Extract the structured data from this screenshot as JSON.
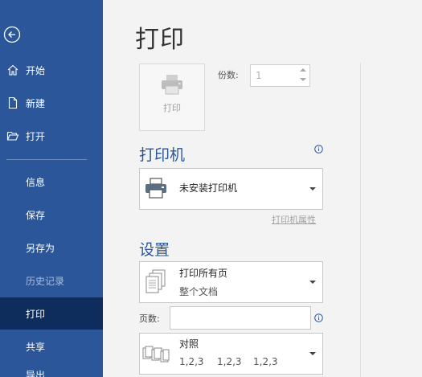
{
  "sidebar": {
    "top_items": [
      {
        "label": "开始",
        "icon": "home-icon"
      },
      {
        "label": "新建",
        "icon": "new-document-icon"
      },
      {
        "label": "打开",
        "icon": "open-folder-icon"
      }
    ],
    "items": [
      {
        "label": "信息",
        "state": "normal"
      },
      {
        "label": "保存",
        "state": "normal"
      },
      {
        "label": "另存为",
        "state": "normal"
      },
      {
        "label": "历史记录",
        "state": "disabled"
      },
      {
        "label": "打印",
        "state": "active"
      },
      {
        "label": "共享",
        "state": "normal"
      },
      {
        "label": "导出",
        "state": "normal"
      }
    ]
  },
  "main": {
    "title": "打印",
    "print_button": {
      "label": "打印",
      "icon": "printer-icon"
    },
    "copies": {
      "label": "份数:",
      "value": "1"
    },
    "printer_section": {
      "title": "打印机",
      "selected": "未安装打印机",
      "properties_link": "打印机属性"
    },
    "settings_section": {
      "title": "设置",
      "print_range": {
        "line1": "打印所有页",
        "line2": "整个文档"
      },
      "pages": {
        "label": "页数:",
        "value": ""
      },
      "collate": {
        "title": "对照",
        "sequences": [
          "1,2,3",
          "1,2,3",
          "1,2,3"
        ]
      }
    }
  },
  "colors": {
    "sidebar_bg": "#2b579a",
    "sidebar_active": "#0e2d5c",
    "accent": "#2b579a",
    "main_bg": "#f3f3f3"
  }
}
